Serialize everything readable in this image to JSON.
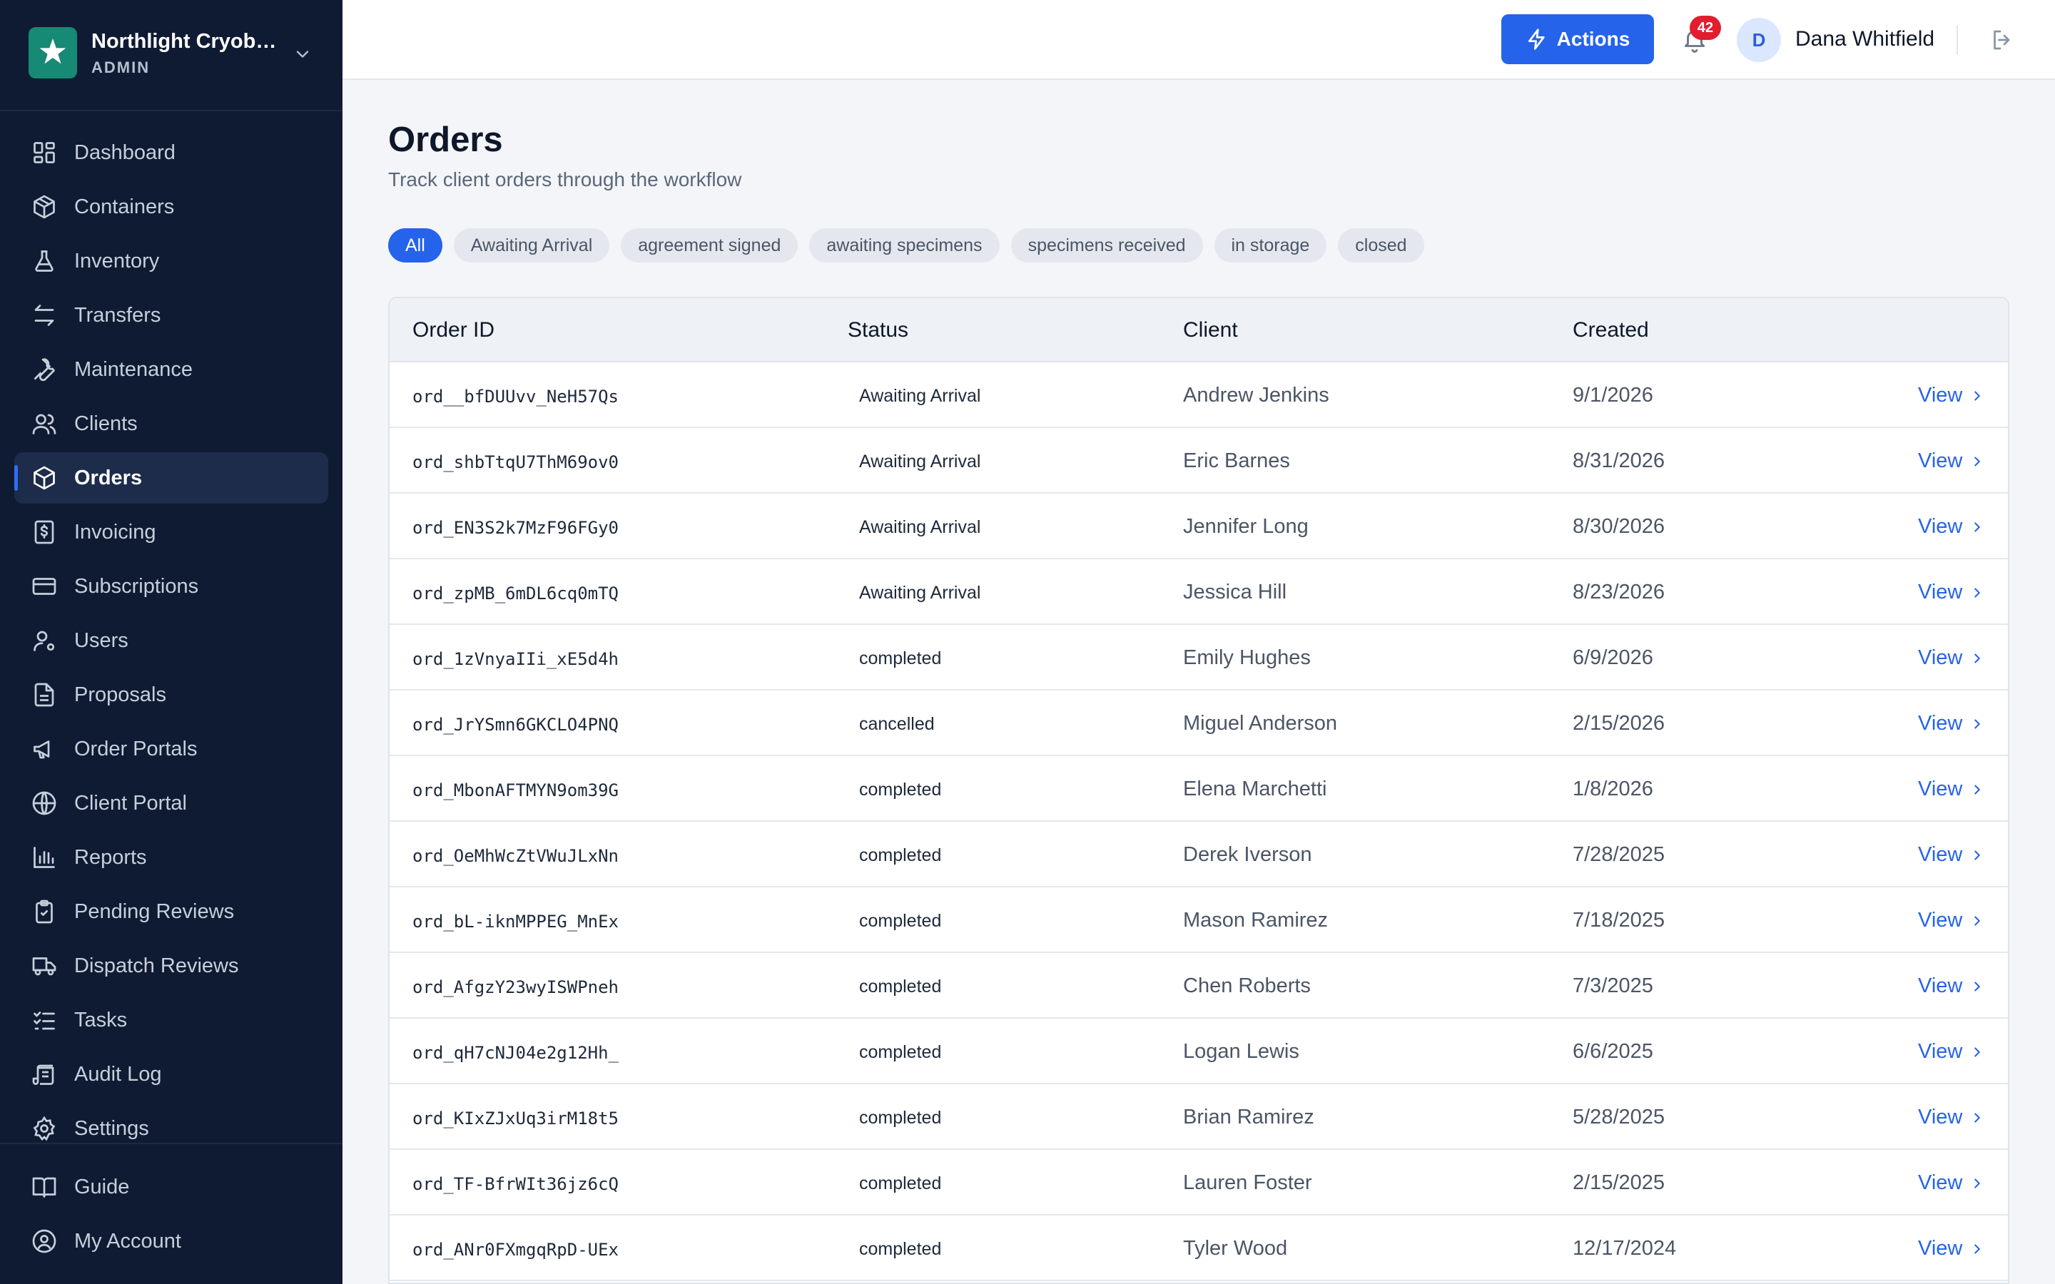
{
  "org": {
    "name": "Northlight Cryoba...",
    "role": "ADMIN"
  },
  "nav": {
    "items": [
      {
        "label": "Dashboard",
        "icon": "dashboard-icon"
      },
      {
        "label": "Containers",
        "icon": "box-icon"
      },
      {
        "label": "Inventory",
        "icon": "flask-icon"
      },
      {
        "label": "Transfers",
        "icon": "transfer-icon"
      },
      {
        "label": "Maintenance",
        "icon": "wrench-icon"
      },
      {
        "label": "Clients",
        "icon": "users-icon"
      },
      {
        "label": "Orders",
        "icon": "package-icon"
      },
      {
        "label": "Invoicing",
        "icon": "invoice-icon"
      },
      {
        "label": "Subscriptions",
        "icon": "credit-card-icon"
      },
      {
        "label": "Users",
        "icon": "user-cog-icon"
      },
      {
        "label": "Proposals",
        "icon": "document-icon"
      },
      {
        "label": "Order Portals",
        "icon": "megaphone-icon"
      },
      {
        "label": "Client Portal",
        "icon": "globe-icon"
      },
      {
        "label": "Reports",
        "icon": "bar-chart-icon"
      },
      {
        "label": "Pending Reviews",
        "icon": "clipboard-icon"
      },
      {
        "label": "Dispatch Reviews",
        "icon": "truck-icon"
      },
      {
        "label": "Tasks",
        "icon": "list-check-icon"
      },
      {
        "label": "Audit Log",
        "icon": "scroll-icon"
      },
      {
        "label": "Settings",
        "icon": "gear-icon"
      }
    ],
    "bottom": [
      {
        "label": "Guide",
        "icon": "book-icon"
      },
      {
        "label": "My Account",
        "icon": "user-circle-icon"
      }
    ],
    "active": "Orders"
  },
  "topbar": {
    "actions_label": "Actions",
    "notification_count": "42",
    "avatar_initial": "D",
    "user_name": "Dana Whitfield"
  },
  "page": {
    "title": "Orders",
    "subtitle": "Track client orders through the workflow"
  },
  "filters": [
    "All",
    "Awaiting Arrival",
    "agreement signed",
    "awaiting specimens",
    "specimens received",
    "in storage",
    "closed"
  ],
  "active_filter": "All",
  "table": {
    "columns": [
      "Order ID",
      "Status",
      "Client",
      "Created"
    ],
    "view_label": "View",
    "rows": [
      {
        "id": "ord__bfDUUvv_NeH57Qs",
        "status": "Awaiting Arrival",
        "client": "Andrew Jenkins",
        "created": "9/1/2026"
      },
      {
        "id": "ord_shbTtqU7ThM69ov0",
        "status": "Awaiting Arrival",
        "client": "Eric Barnes",
        "created": "8/31/2026"
      },
      {
        "id": "ord_EN3S2k7MzF96FGy0",
        "status": "Awaiting Arrival",
        "client": "Jennifer Long",
        "created": "8/30/2026"
      },
      {
        "id": "ord_zpMB_6mDL6cq0mTQ",
        "status": "Awaiting Arrival",
        "client": "Jessica Hill",
        "created": "8/23/2026"
      },
      {
        "id": "ord_1zVnyaIIi_xE5d4h",
        "status": "completed",
        "client": "Emily Hughes",
        "created": "6/9/2026"
      },
      {
        "id": "ord_JrYSmn6GKCLO4PNQ",
        "status": "cancelled",
        "client": "Miguel Anderson",
        "created": "2/15/2026"
      },
      {
        "id": "ord_MbonAFTMYN9om39G",
        "status": "completed",
        "client": "Elena Marchetti",
        "created": "1/8/2026"
      },
      {
        "id": "ord_OeMhWcZtVWuJLxNn",
        "status": "completed",
        "client": "Derek Iverson",
        "created": "7/28/2025"
      },
      {
        "id": "ord_bL-iknMPPEG_MnEx",
        "status": "completed",
        "client": "Mason Ramirez",
        "created": "7/18/2025"
      },
      {
        "id": "ord_AfgzY23wyISWPneh",
        "status": "completed",
        "client": "Chen Roberts",
        "created": "7/3/2025"
      },
      {
        "id": "ord_qH7cNJ04e2g12Hh_",
        "status": "completed",
        "client": "Logan Lewis",
        "created": "6/6/2025"
      },
      {
        "id": "ord_KIxZJxUq3irM18t5",
        "status": "completed",
        "client": "Brian Ramirez",
        "created": "5/28/2025"
      },
      {
        "id": "ord_TF-BfrWIt36jz6cQ",
        "status": "completed",
        "client": "Lauren Foster",
        "created": "2/15/2025"
      },
      {
        "id": "ord_ANr0FXmgqRpD-UEx",
        "status": "completed",
        "client": "Tyler Wood",
        "created": "12/17/2024"
      }
    ]
  },
  "colors": {
    "sidebar_bg": "#0f1b32",
    "accent": "#2563eb",
    "badge": "#e11d2e",
    "logo_bg": "#168a74"
  }
}
